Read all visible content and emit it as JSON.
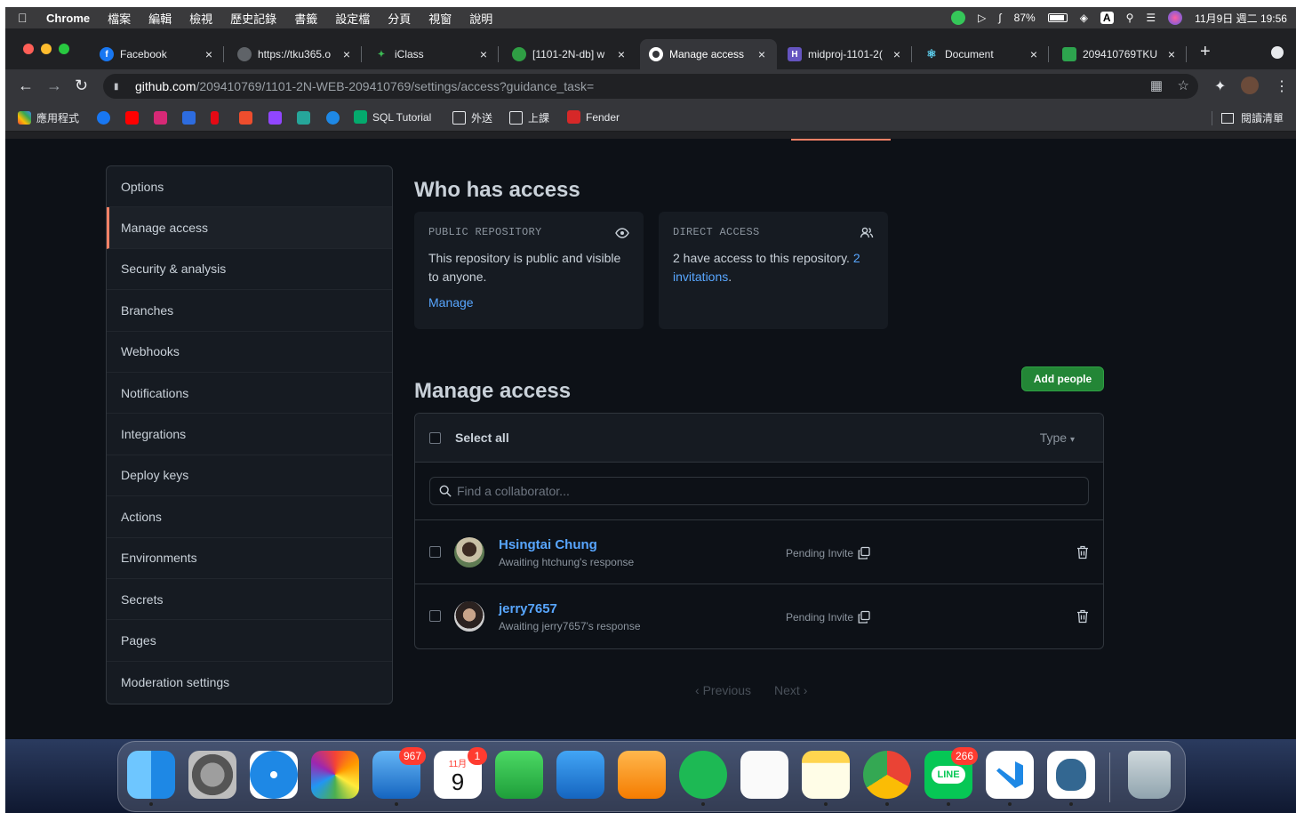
{
  "menubar": {
    "app": "Chrome",
    "menus": [
      "檔案",
      "編輯",
      "檢視",
      "歷史記錄",
      "書籤",
      "設定檔",
      "分頁",
      "視窗",
      "說明"
    ],
    "battery": "87%",
    "input_label": "A",
    "datetime": "11月9日 週二  19:56"
  },
  "tabs": [
    {
      "title": "Facebook",
      "fav_color": "#1877f2",
      "fav_text": "f"
    },
    {
      "title": "https://tku365.o",
      "fav_color": "#5f6368",
      "fav_text": ""
    },
    {
      "title": "iClass",
      "fav_color": "#3cba54",
      "fav_text": ""
    },
    {
      "title": "[1101-2N-db] w",
      "fav_color": "#2f9e44",
      "fav_text": ""
    },
    {
      "title": "Manage access",
      "fav_color": "#ffffff",
      "fav_text": ""
    },
    {
      "title": "midproj-1101-2(",
      "fav_color": "#6554c0",
      "fav_text": "H"
    },
    {
      "title": "Document",
      "fav_color": "#61dafb",
      "fav_text": ""
    },
    {
      "title": "209410769TKU",
      "fav_color": "#2da44e",
      "fav_text": ""
    }
  ],
  "address": {
    "host": "github.com",
    "path": "/209410769/1101-2N-WEB-209410769/settings/access?guidance_task="
  },
  "bookmarks": {
    "apps": "應用程式",
    "sql": "SQL Tutorial",
    "folder1": "外送",
    "folder2": "上課",
    "fender": "Fender",
    "reading_list": "閱讀清單"
  },
  "sidebar": {
    "items": [
      "Options",
      "Manage access",
      "Security & analysis",
      "Branches",
      "Webhooks",
      "Notifications",
      "Integrations",
      "Deploy keys",
      "Actions",
      "Environments",
      "Secrets",
      "Pages",
      "Moderation settings"
    ],
    "selected": "Manage access"
  },
  "who": {
    "title": "Who has access",
    "public": {
      "kicker": "PUBLIC REPOSITORY",
      "text": "This repository is public and visible to anyone.",
      "manage": "Manage"
    },
    "direct": {
      "kicker": "DIRECT ACCESS",
      "text": "2 have access to this repository.",
      "link": "2 invitations",
      "period": "."
    }
  },
  "manage": {
    "title": "Manage access",
    "add_button": "Add people",
    "select_all": "Select all",
    "type_filter": "Type",
    "search_placeholder": "Find a collaborator...",
    "rows": [
      {
        "name": "Hsingtai Chung",
        "sub": "Awaiting htchung's response",
        "status": "Pending Invite"
      },
      {
        "name": "jerry7657",
        "sub": "Awaiting jerry7657's response",
        "status": "Pending Invite"
      }
    ],
    "previous": "Previous",
    "next": "Next"
  },
  "dock": {
    "mail_badge": "967",
    "calendar_month": "11月",
    "calendar_day": "9",
    "calendar_badge": "1",
    "line_badge": "266",
    "line_label": "LINE"
  }
}
